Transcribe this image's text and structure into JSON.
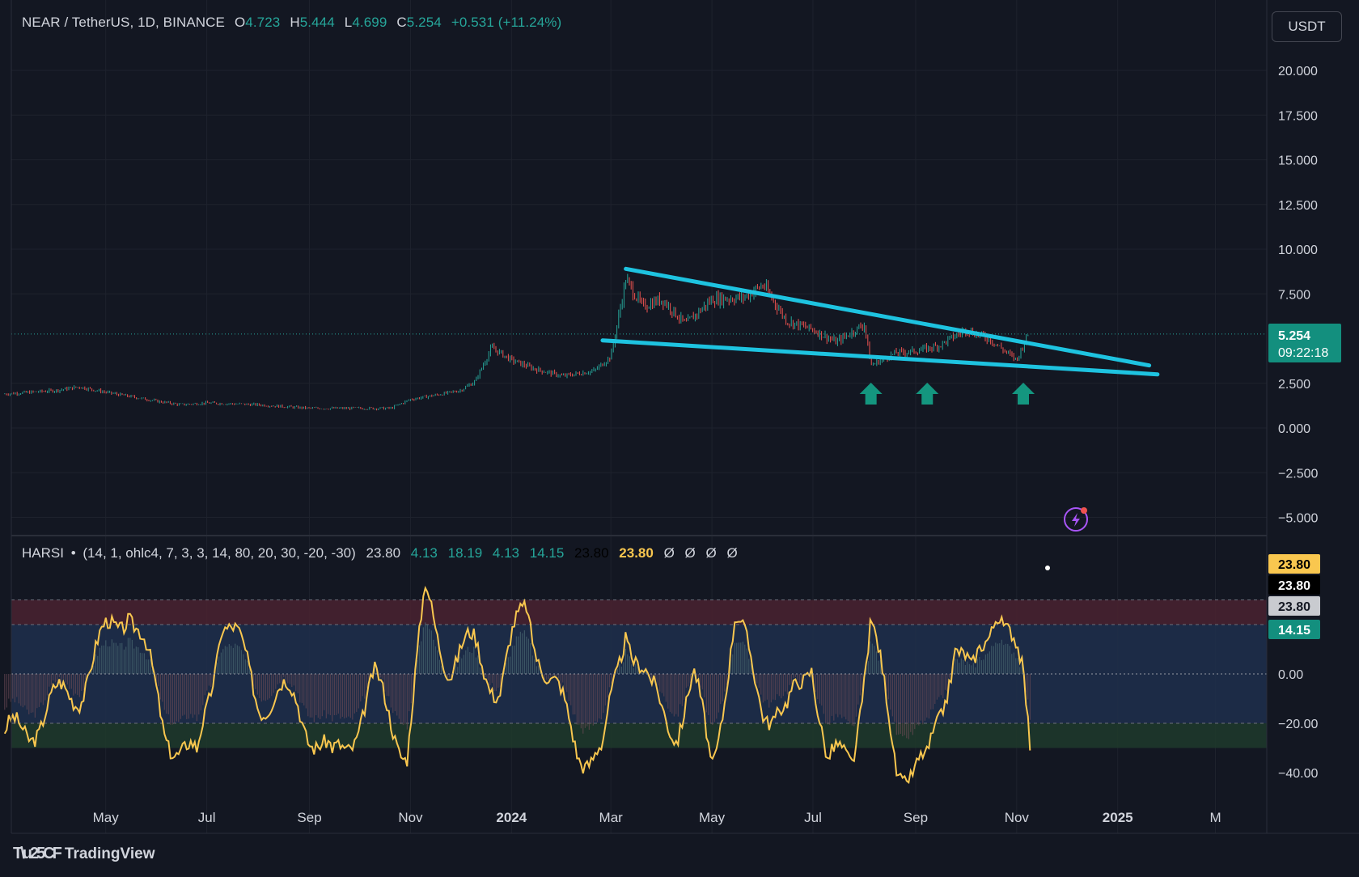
{
  "header": {
    "symbol": "NEAR / TetherUS, 1D, BINANCE",
    "o_label": "O",
    "o_value": "4.723",
    "h_label": "H",
    "h_value": "5.444",
    "l_label": "L",
    "l_value": "4.699",
    "c_label": "C",
    "c_value": "5.254",
    "change": "+0.531 (+11.24%)"
  },
  "currency_button": "USDT",
  "price_scale": {
    "ticks": [
      "20.000",
      "17.500",
      "15.000",
      "12.500",
      "10.000",
      "7.500",
      "2.500",
      "0.000",
      "−2.500",
      "−5.000"
    ],
    "tick_values": [
      20,
      17.5,
      15,
      12.5,
      10,
      7.5,
      2.5,
      0,
      -2.5,
      -5
    ],
    "last_price": "5.254",
    "countdown": "09:22:18"
  },
  "indicator": {
    "name": "HARSI",
    "dot": "•",
    "params": "(14, 1, ohlc4, 7, 3, 3, 14, 80, 20, 30, -20, -30)",
    "values": [
      "23.80",
      "4.13",
      "18.19",
      "4.13",
      "14.15",
      "23.80",
      "23.80",
      "Ø",
      "Ø",
      "Ø",
      "Ø"
    ],
    "value_colors": [
      "#d1d4dc",
      "#26a69a",
      "#26a69a",
      "#26a69a",
      "#26a69a",
      "#000000",
      "#f9c74f",
      "#d1d4dc",
      "#d1d4dc",
      "#d1d4dc",
      "#d1d4dc"
    ],
    "scale_ticks": [
      "0.00",
      "−20.00",
      "−40.00"
    ],
    "scale_tick_values": [
      0,
      -20,
      -40
    ],
    "badges": [
      {
        "text": "23.80",
        "bg": "#f9c74f",
        "fg": "#000000"
      },
      {
        "text": "23.80",
        "bg": "#000000",
        "fg": "#ffffff"
      },
      {
        "text": "23.80",
        "bg": "#c9cbd0",
        "fg": "#131722"
      },
      {
        "text": "14.15",
        "bg": "#138f7e",
        "fg": "#ffffff"
      }
    ]
  },
  "time_axis": [
    "May",
    "Jul",
    "Sep",
    "Nov",
    "2024",
    "Mar",
    "May",
    "Jul",
    "Sep",
    "Nov",
    "2025",
    "M"
  ],
  "brand": "TradingView",
  "icons": [
    "lightning-icon",
    "up-arrow-icon",
    "tradingview-logo-icon"
  ],
  "colors": {
    "background": "#131722",
    "up": "#26a69a",
    "down": "#ef5350",
    "trendline": "#1ec3e0",
    "oscillator": "#f9c74f"
  },
  "chart_data": {
    "type": "line",
    "title": "NEAR / TetherUS, 1D, BINANCE",
    "ylim": [
      -6,
      22
    ],
    "price_series": {
      "name": "NEAR/USDT",
      "x": [
        "2023-03-01",
        "2023-04-01",
        "2023-04-15",
        "2023-05-01",
        "2023-06-01",
        "2023-06-15",
        "2023-07-01",
        "2023-08-01",
        "2023-09-01",
        "2023-10-01",
        "2023-10-20",
        "2023-11-01",
        "2023-11-20",
        "2023-12-01",
        "2023-12-10",
        "2023-12-20",
        "2024-01-01",
        "2024-01-15",
        "2024-02-01",
        "2024-02-20",
        "2024-03-01",
        "2024-03-10",
        "2024-03-20",
        "2024-04-01",
        "2024-04-15",
        "2024-05-01",
        "2024-05-20",
        "2024-06-01",
        "2024-06-15",
        "2024-07-01",
        "2024-07-15",
        "2024-08-01",
        "2024-08-05",
        "2024-08-20",
        "2024-09-01",
        "2024-09-15",
        "2024-10-01",
        "2024-10-15",
        "2024-11-01",
        "2024-11-08"
      ],
      "y": [
        1.9,
        2.1,
        2.3,
        2.0,
        1.5,
        1.3,
        1.4,
        1.3,
        1.1,
        1.1,
        1.1,
        1.6,
        1.9,
        2.1,
        2.6,
        4.5,
        3.8,
        3.3,
        2.9,
        3.2,
        4.0,
        8.3,
        6.8,
        7.2,
        5.8,
        7.2,
        7.3,
        8.0,
        6.0,
        5.5,
        4.8,
        5.8,
        3.5,
        4.2,
        4.3,
        4.6,
        5.5,
        5.0,
        3.8,
        5.254
      ]
    },
    "trendlines": [
      {
        "name": "upper",
        "x": [
          "2024-03-10",
          "2025-01-20"
        ],
        "y": [
          8.9,
          3.5
        ]
      },
      {
        "name": "lower",
        "x": [
          "2024-02-25",
          "2025-01-25"
        ],
        "y": [
          4.9,
          3.0
        ]
      }
    ],
    "support_markers_x": [
      "2024-08-05",
      "2024-09-08",
      "2024-11-05"
    ],
    "oscillator": {
      "name": "HARSI",
      "ylim": [
        -45,
        30
      ],
      "bands": [
        {
          "from": 20,
          "to": 30,
          "color": "#4a2230"
        },
        {
          "from": -20,
          "to": 20,
          "color": "#1e2f4c"
        },
        {
          "from": -30,
          "to": -20,
          "color": "#1f3a2c"
        }
      ],
      "x": [
        "2023-03-01",
        "2023-04-15",
        "2023-05-15",
        "2023-06-05",
        "2023-06-25",
        "2023-07-10",
        "2023-08-01",
        "2023-08-25",
        "2023-09-15",
        "2023-10-10",
        "2023-10-30",
        "2023-11-10",
        "2023-11-25",
        "2023-12-10",
        "2023-12-25",
        "2024-01-10",
        "2024-01-25",
        "2024-02-10",
        "2024-02-25",
        "2024-03-10",
        "2024-03-25",
        "2024-04-10",
        "2024-04-20",
        "2024-05-01",
        "2024-05-15",
        "2024-06-01",
        "2024-06-15",
        "2024-06-30",
        "2024-07-10",
        "2024-07-25",
        "2024-08-05",
        "2024-08-20",
        "2024-09-08",
        "2024-09-25",
        "2024-10-05",
        "2024-10-20",
        "2024-11-05",
        "2024-11-10"
      ],
      "y": [
        -28,
        -5,
        30,
        -20,
        -38,
        25,
        -8,
        -12,
        -38,
        -5,
        -30,
        30,
        5,
        10,
        -5,
        28,
        -5,
        -28,
        -35,
        22,
        -10,
        -20,
        -5,
        -35,
        20,
        -10,
        -20,
        10,
        -40,
        -30,
        20,
        -35,
        -40,
        15,
        -5,
        32,
        -5,
        -33
      ]
    }
  }
}
